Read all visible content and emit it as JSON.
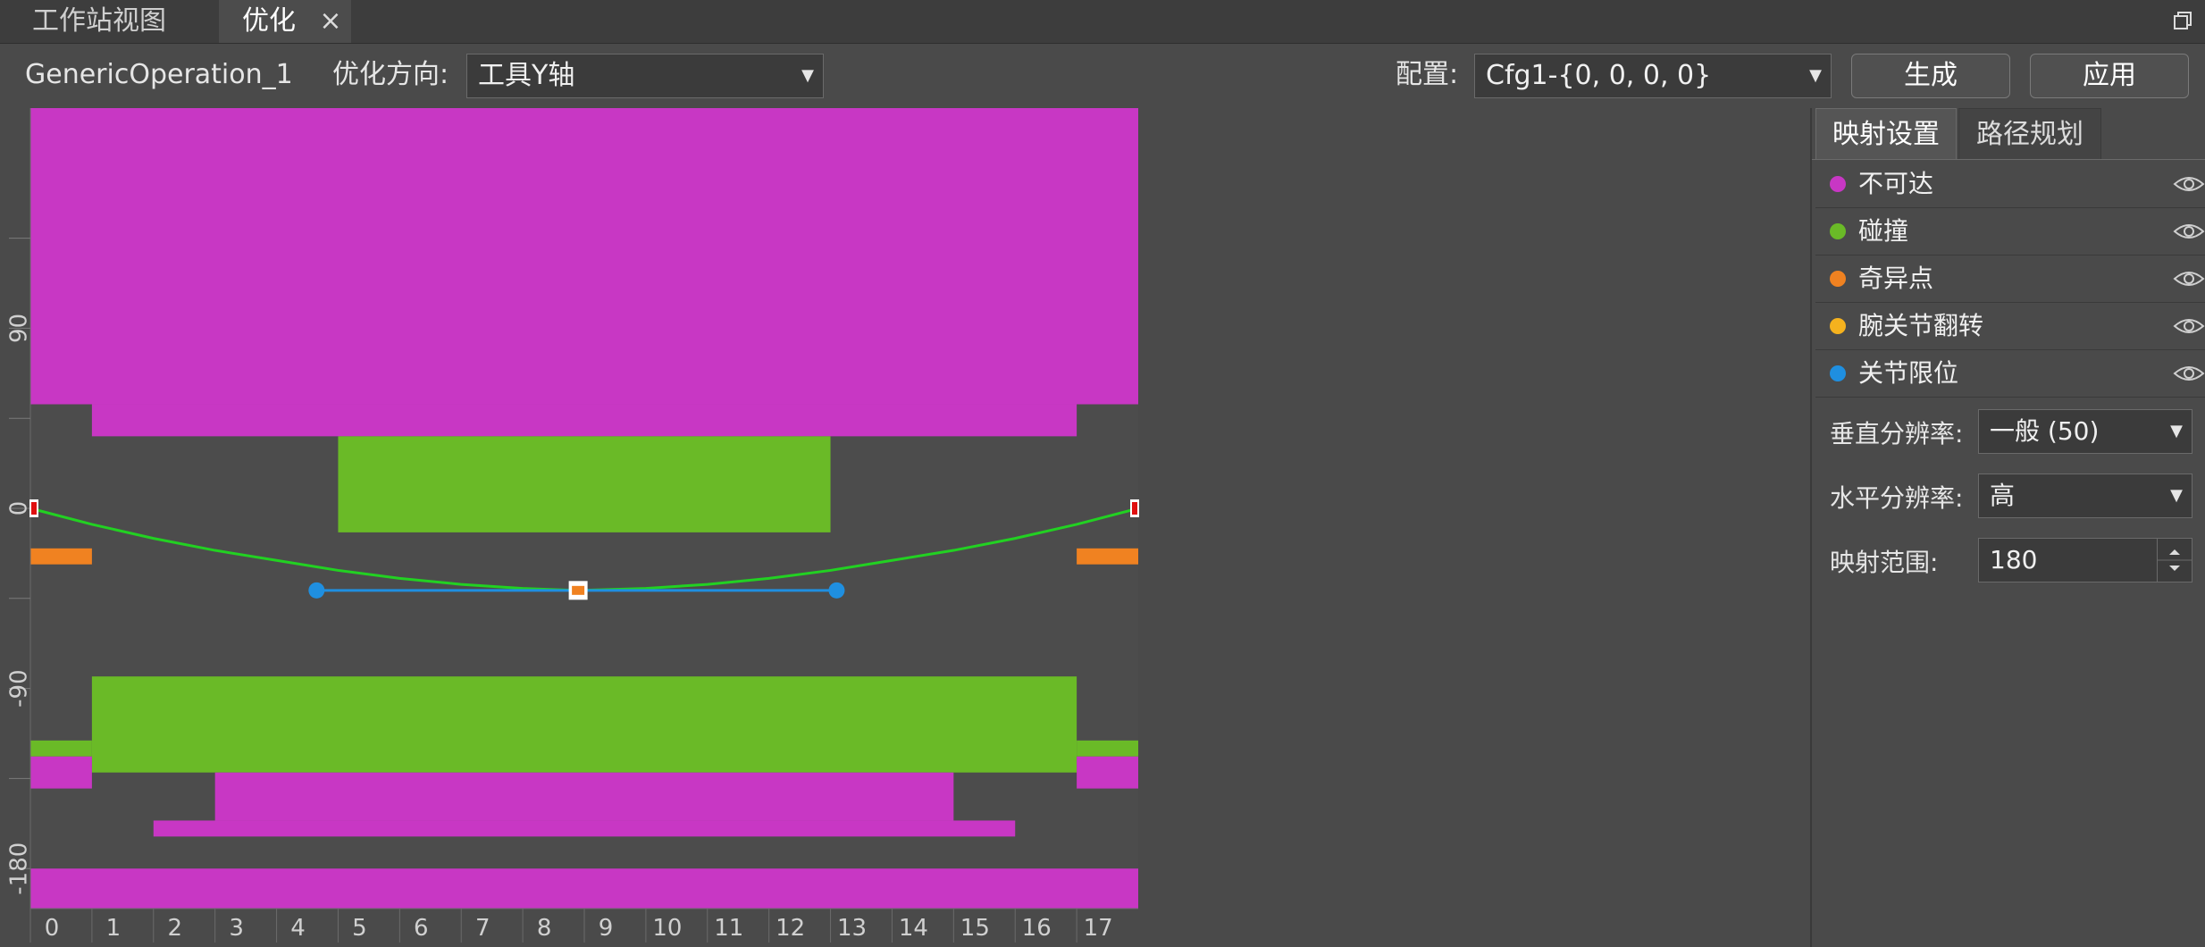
{
  "tabs": [
    {
      "label": "工作站视图"
    },
    {
      "label": "优化",
      "close": "×"
    }
  ],
  "toolbar": {
    "operation_name": "GenericOperation_1",
    "direction_label": "优化方向:",
    "direction_value": "工具Y轴",
    "config_label": "配置:",
    "config_value": "Cfg1-{0, 0, 0, 0}",
    "generate_button": "生成",
    "apply_button": "应用"
  },
  "panel": {
    "tabs": [
      {
        "label": "映射设置"
      },
      {
        "label": "路径规划"
      }
    ],
    "legend": [
      {
        "label": "不可达",
        "color": "#c837c4"
      },
      {
        "label": "碰撞",
        "color": "#6aba27"
      },
      {
        "label": "奇异点",
        "color": "#f08221"
      },
      {
        "label": "腕关节翻转",
        "color": "#f5b21e"
      },
      {
        "label": "关节限位",
        "color": "#1f8fe0"
      }
    ],
    "vertical_res_label": "垂直分辨率:",
    "vertical_res_value": "一般 (50)",
    "horizontal_res_label": "水平分辨率:",
    "horizontal_res_value": "高",
    "range_label": "映射范围:",
    "range_value": "180"
  },
  "chart_data": {
    "type": "heatmap",
    "xlim": [
      0,
      18
    ],
    "ylim": [
      -200,
      200
    ],
    "x_ticks": [
      0,
      1,
      2,
      3,
      4,
      5,
      6,
      7,
      8,
      9,
      10,
      11,
      12,
      13,
      14,
      15,
      16,
      17
    ],
    "y_ticks": [
      90,
      0,
      -90,
      -180
    ],
    "colors": {
      "background": "#4c4c4c",
      "unreachable": "#c837c4",
      "collision": "#6aba27",
      "singularity": "#f08221",
      "joint_limit": "#1f8fe0",
      "path": "#22d122",
      "endpoint": "#e01010"
    },
    "regions": [
      {
        "cat": "unreachable",
        "x": [
          0,
          18
        ],
        "y": [
          52,
          200
        ]
      },
      {
        "cat": "unreachable",
        "x": [
          1,
          17
        ],
        "y": [
          36,
          52
        ]
      },
      {
        "cat": "collision",
        "x": [
          5,
          13
        ],
        "y": [
          -12,
          36
        ]
      },
      {
        "cat": "singularity",
        "x": [
          0,
          1
        ],
        "y": [
          -28,
          -20
        ]
      },
      {
        "cat": "singularity",
        "x": [
          17,
          18
        ],
        "y": [
          -28,
          -20
        ]
      },
      {
        "cat": "collision",
        "x": [
          1,
          17
        ],
        "y": [
          -132,
          -84
        ]
      },
      {
        "cat": "collision",
        "x": [
          0,
          1
        ],
        "y": [
          -124,
          -116
        ]
      },
      {
        "cat": "collision",
        "x": [
          17,
          18
        ],
        "y": [
          -124,
          -116
        ]
      },
      {
        "cat": "unreachable",
        "x": [
          0,
          1
        ],
        "y": [
          -140,
          -124
        ]
      },
      {
        "cat": "unreachable",
        "x": [
          17,
          18
        ],
        "y": [
          -140,
          -124
        ]
      },
      {
        "cat": "unreachable",
        "x": [
          3,
          15
        ],
        "y": [
          -156,
          -132
        ]
      },
      {
        "cat": "unreachable",
        "x": [
          2,
          16
        ],
        "y": [
          -164,
          -156
        ]
      },
      {
        "cat": "unreachable",
        "x": [
          0,
          18
        ],
        "y": [
          -200,
          -180
        ]
      }
    ],
    "path": {
      "x": [
        0,
        1,
        2,
        3,
        4,
        5,
        6,
        7,
        8,
        8.9,
        10,
        11,
        12,
        13,
        14,
        15,
        16,
        17,
        18
      ],
      "y": [
        0,
        -8,
        -15,
        -21,
        -26,
        -31,
        -35,
        -38,
        -40,
        -41,
        -40,
        -38,
        -35,
        -31,
        -26,
        -21,
        -15,
        -8,
        0
      ]
    },
    "handle_line": {
      "x": [
        4.65,
        8.9,
        13.1
      ],
      "y": [
        -41,
        -41,
        -41
      ]
    },
    "waypoint": {
      "x": 8.9,
      "y": -41
    }
  }
}
